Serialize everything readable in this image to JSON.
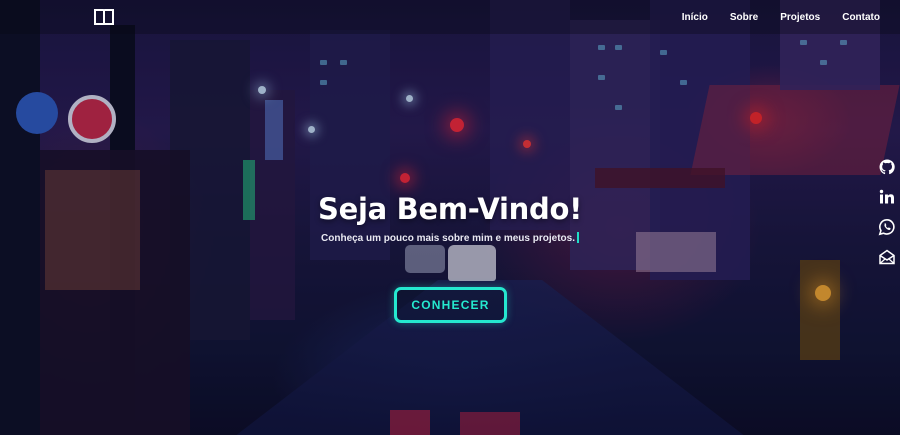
{
  "navbar": {
    "logo_icon": "book-icon",
    "links": [
      {
        "label": "Início"
      },
      {
        "label": "Sobre"
      },
      {
        "label": "Projetos"
      },
      {
        "label": "Contato"
      }
    ]
  },
  "hero": {
    "title": "Seja Bem-Vindo!",
    "subtitle": "Conheça um pouco mais sobre mim e meus projetos.",
    "cta_label": "CONHECER"
  },
  "social": [
    {
      "icon": "github-icon"
    },
    {
      "icon": "linkedin-icon"
    },
    {
      "icon": "whatsapp-icon"
    },
    {
      "icon": "email-icon"
    }
  ],
  "colors": {
    "accent": "#25e8cf",
    "text": "#ffffff",
    "background": "#1c1645"
  }
}
